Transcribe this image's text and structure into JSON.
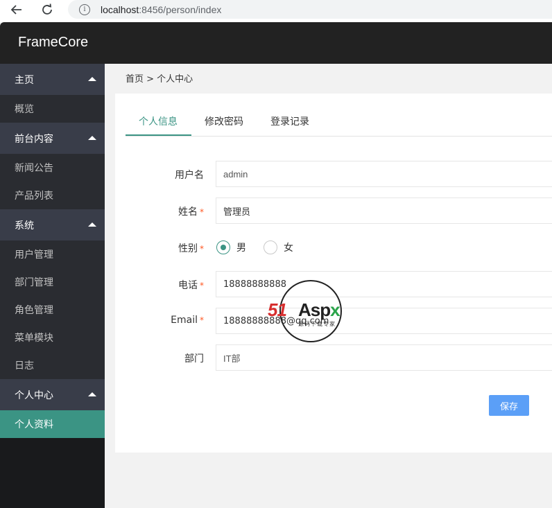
{
  "browser": {
    "url_host": "localhost",
    "url_rest": ":8456/person/index"
  },
  "app": {
    "title": "FrameCore"
  },
  "sidebar": {
    "groups": [
      {
        "label": "主页",
        "items": [
          {
            "label": "概览"
          }
        ]
      },
      {
        "label": "前台内容",
        "items": [
          {
            "label": "新闻公告"
          },
          {
            "label": "产品列表"
          }
        ]
      },
      {
        "label": "系统",
        "items": [
          {
            "label": "用户管理"
          },
          {
            "label": "部门管理"
          },
          {
            "label": "角色管理"
          },
          {
            "label": "菜单模块"
          },
          {
            "label": "日志"
          }
        ]
      },
      {
        "label": "个人中心",
        "items": [
          {
            "label": "个人资料"
          }
        ]
      }
    ],
    "active_item": "个人资料"
  },
  "breadcrumb": "首页 > 个人中心",
  "tabs": [
    {
      "label": "个人信息",
      "active": true
    },
    {
      "label": "修改密码",
      "active": false
    },
    {
      "label": "登录记录",
      "active": false
    }
  ],
  "form": {
    "username": {
      "label": "用户名",
      "value": "admin"
    },
    "name": {
      "label": "姓名",
      "value": "管理员",
      "required": "*"
    },
    "gender": {
      "label": "性别",
      "required": "*",
      "options": [
        "男",
        "女"
      ],
      "selected": "男"
    },
    "phone": {
      "label": "电话",
      "value": "18888888888",
      "required": "*"
    },
    "email": {
      "label": "Email",
      "value": "18888888888@qq.com",
      "required": "*"
    },
    "department": {
      "label": "部门",
      "value": "IT部"
    },
    "save_label": "保存"
  },
  "watermark": {
    "brand_red": "51",
    "brand_dark": "Asp",
    "brand_green": "x",
    "tagline": "源码下载专家"
  },
  "colors": {
    "accent": "#3b9484",
    "topbar": "#222222",
    "sidebar": "#191a1c",
    "button": "#5b9ff7",
    "required": "#ff5722"
  }
}
